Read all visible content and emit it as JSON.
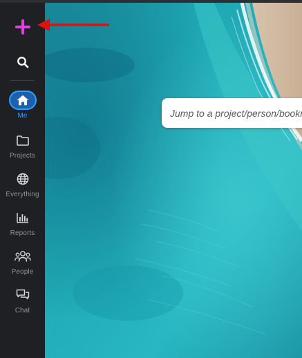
{
  "sidebar": {
    "add_icon": "plus-icon",
    "search_icon": "search-icon",
    "items": [
      {
        "label": "Me",
        "icon": "home-icon",
        "active": true
      },
      {
        "label": "Projects",
        "icon": "folder-icon",
        "active": false
      },
      {
        "label": "Everything",
        "icon": "globe-icon",
        "active": false
      },
      {
        "label": "Reports",
        "icon": "bar-chart-icon",
        "active": false
      },
      {
        "label": "People",
        "icon": "people-icon",
        "active": false
      },
      {
        "label": "Chat",
        "icon": "chat-icon",
        "active": false
      }
    ]
  },
  "jump": {
    "placeholder": "Jump to a project/person/bookmark"
  },
  "colors": {
    "accent": "#2aa0ff",
    "plus": "#e040e0",
    "arrow": "#e01010",
    "sidebar_bg": "#1f2023"
  }
}
